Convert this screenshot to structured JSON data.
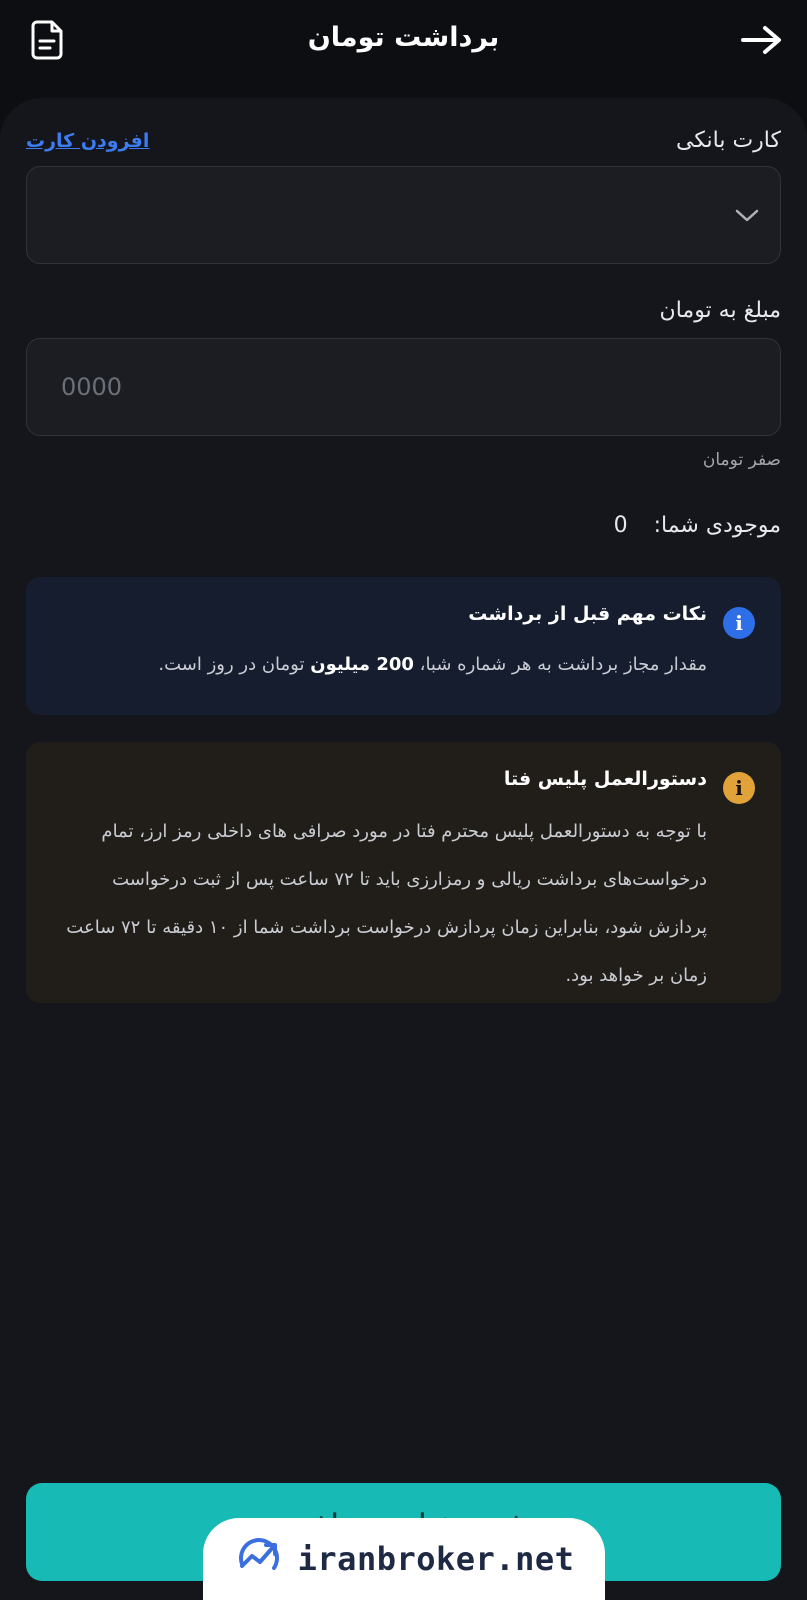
{
  "header": {
    "title": "برداشت تومان",
    "back_icon": "arrow-right-icon",
    "doc_icon": "document-icon"
  },
  "form": {
    "bank_card_label": "کارت بانکی",
    "add_card_link": "افزودن کارت",
    "select_chevron_icon": "chevron-down-icon",
    "amount_label": "مبلغ به تومان",
    "amount_placeholder": "0000",
    "amount_hint": "صفر تومان",
    "balance_label": "موجودی شما:",
    "balance_value": "0"
  },
  "notice_important": {
    "icon": "info-icon",
    "title": "نکات مهم قبل از برداشت",
    "body_prefix": "مقدار مجاز برداشت به هر شماره شبا،",
    "body_bold": "200 میلیون",
    "body_suffix": "تومان در روز است.",
    "color": "#2e6ee6"
  },
  "notice_police": {
    "icon": "info-icon",
    "title": "دستورالعمل پلیس فتا",
    "body": "با توجه به دستورالعمل پلیس محترم فتا در مورد صرافی های داخلی رمز ارز، تمام درخواست‌های برداشت ریالی و رمزارزی باید تا ۷۲ ساعت پس از ثبت درخواست پردازش شود، بنابراین زمان پردازش درخواست برداشت شما از ۱۰ دقیقه تا ۷۲ ساعت زمان بر خواهد بود.",
    "color": "#e1a23a"
  },
  "submit": {
    "label": "ثبت درخواست برداشت",
    "color": "#18bab5"
  },
  "watermark": {
    "text": "iranbroker.net",
    "logo": "chart-trend-logo-icon"
  }
}
